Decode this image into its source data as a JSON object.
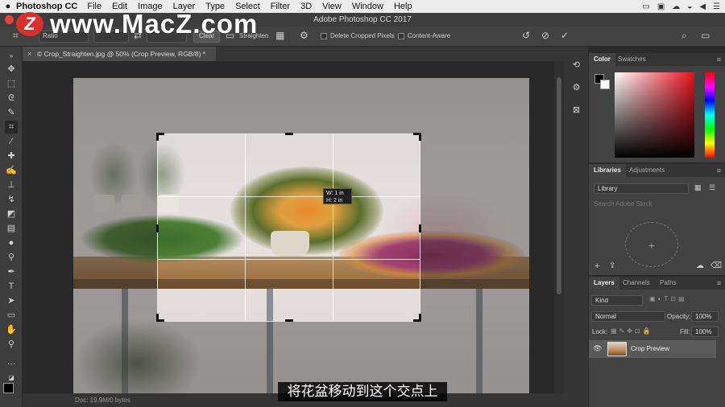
{
  "menubar": {
    "app": "Photoshop CC",
    "items": [
      "File",
      "Edit",
      "Image",
      "Layer",
      "Type",
      "Select",
      "Filter",
      "3D",
      "View",
      "Window",
      "Help"
    ]
  },
  "window": {
    "title": "Adobe Photoshop CC 2017"
  },
  "watermark": {
    "logo_letter": "Z",
    "text": "www.MacZ.com"
  },
  "options": {
    "ratio": "Ratio",
    "clear": "Clear",
    "straighten": "Straighten",
    "delete_cropped": "Delete Cropped Pixels",
    "content_aware": "Content-Aware"
  },
  "document": {
    "tab_title": "© Crop_Straighten.jpg @ 50% (Crop Preview, RGB/8) *",
    "status": "Doc: 19.9M/0 bytes"
  },
  "crop_tooltip": {
    "w": "W: 1 in",
    "h": "H: 2 in"
  },
  "subtitle": "将花盆移动到这个交点上",
  "panels": {
    "color": {
      "tabs": [
        "Color",
        "Swatches"
      ],
      "fg": "#000000",
      "bg": "#ffffff"
    },
    "libraries": {
      "tabs": [
        "Libraries",
        "Adjustments"
      ],
      "selected": "Library",
      "search_placeholder": "Search Adobe Stock"
    },
    "layers": {
      "tabs": [
        "Layers",
        "Channels",
        "Paths"
      ],
      "kind": "Kind",
      "blend_mode": "Normal",
      "opacity_label": "Opacity:",
      "opacity": "100%",
      "lock_label": "Lock:",
      "fill_label": "Fill:",
      "fill": "100%",
      "layer_name": "Crop Preview"
    }
  },
  "colors": {
    "accent": "#e0443e",
    "panel_bg": "#424242"
  }
}
